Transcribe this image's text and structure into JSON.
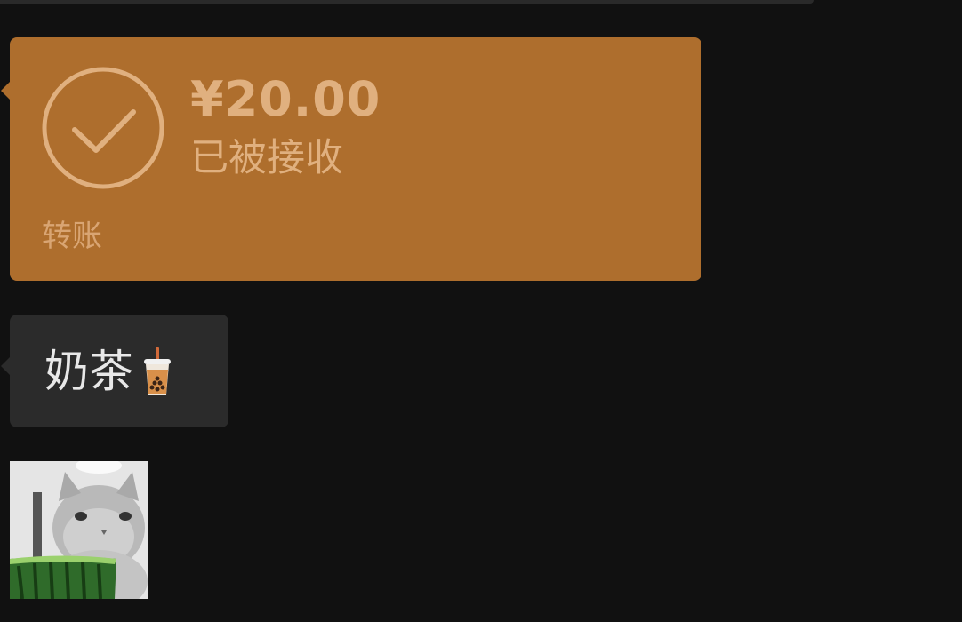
{
  "messages": [
    {
      "type": "transfer",
      "amount": "¥20.00",
      "status": "已被接收",
      "label": "转账",
      "colors": {
        "card": "#ae6e2d",
        "text": "#e0b07f"
      },
      "icon": "check-circle-icon"
    },
    {
      "type": "text",
      "text": "奶茶",
      "emoji_icon": "bubble-tea-icon"
    },
    {
      "type": "sticker",
      "icon": "cat-eating-watermelon-sticker"
    }
  ],
  "theme": {
    "background": "#111111",
    "bubble": "#2b2b2b"
  }
}
